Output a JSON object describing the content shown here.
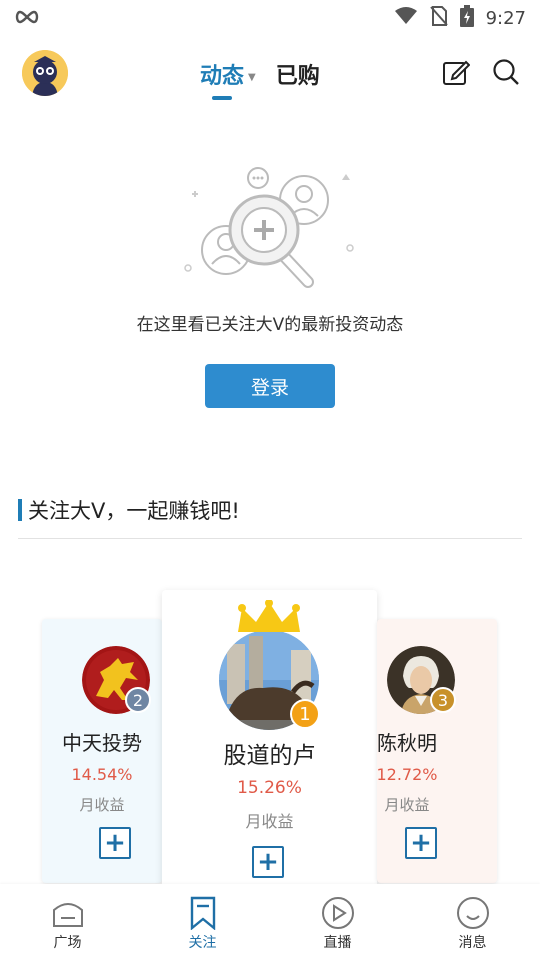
{
  "status_bar": {
    "left_icon": "infinity-icon",
    "time": "9:27",
    "icons": [
      "wifi-icon",
      "no-sim-icon",
      "battery-charging-icon"
    ]
  },
  "header": {
    "tabs": [
      {
        "label": "动态",
        "active": true,
        "has_dropdown": true
      },
      {
        "label": "已购",
        "active": false
      }
    ],
    "icons": [
      "edit-icon",
      "search-icon"
    ],
    "accent_color": "#1f7db6"
  },
  "empty_state": {
    "illustration": "add-person-magnifier-illustration",
    "message": "在这里看已关注大V的最新投资动态",
    "login_label": "登录"
  },
  "section": {
    "title": "关注大V，一起赚钱吧!"
  },
  "cards": [
    {
      "position": "left",
      "rank": "2",
      "name": "中天投势",
      "percent": "14.54%",
      "label": "月收益",
      "follow_icon": "plus-icon"
    },
    {
      "position": "center",
      "rank": "1",
      "name": "股道的卢",
      "percent": "15.26%",
      "label": "月收益",
      "follow_icon": "plus-icon",
      "crown": "crown-icon"
    },
    {
      "position": "right",
      "rank": "3",
      "name": "陈秋明",
      "percent": "12.72%",
      "label": "月收益",
      "follow_icon": "plus-icon"
    }
  ],
  "bottom_nav": [
    {
      "label": "广场",
      "icon": "home-icon",
      "active": false
    },
    {
      "label": "关注",
      "icon": "bookmark-icon",
      "active": true
    },
    {
      "label": "直播",
      "icon": "play-icon",
      "active": false
    },
    {
      "label": "消息",
      "icon": "smile-chat-icon",
      "active": false
    }
  ]
}
